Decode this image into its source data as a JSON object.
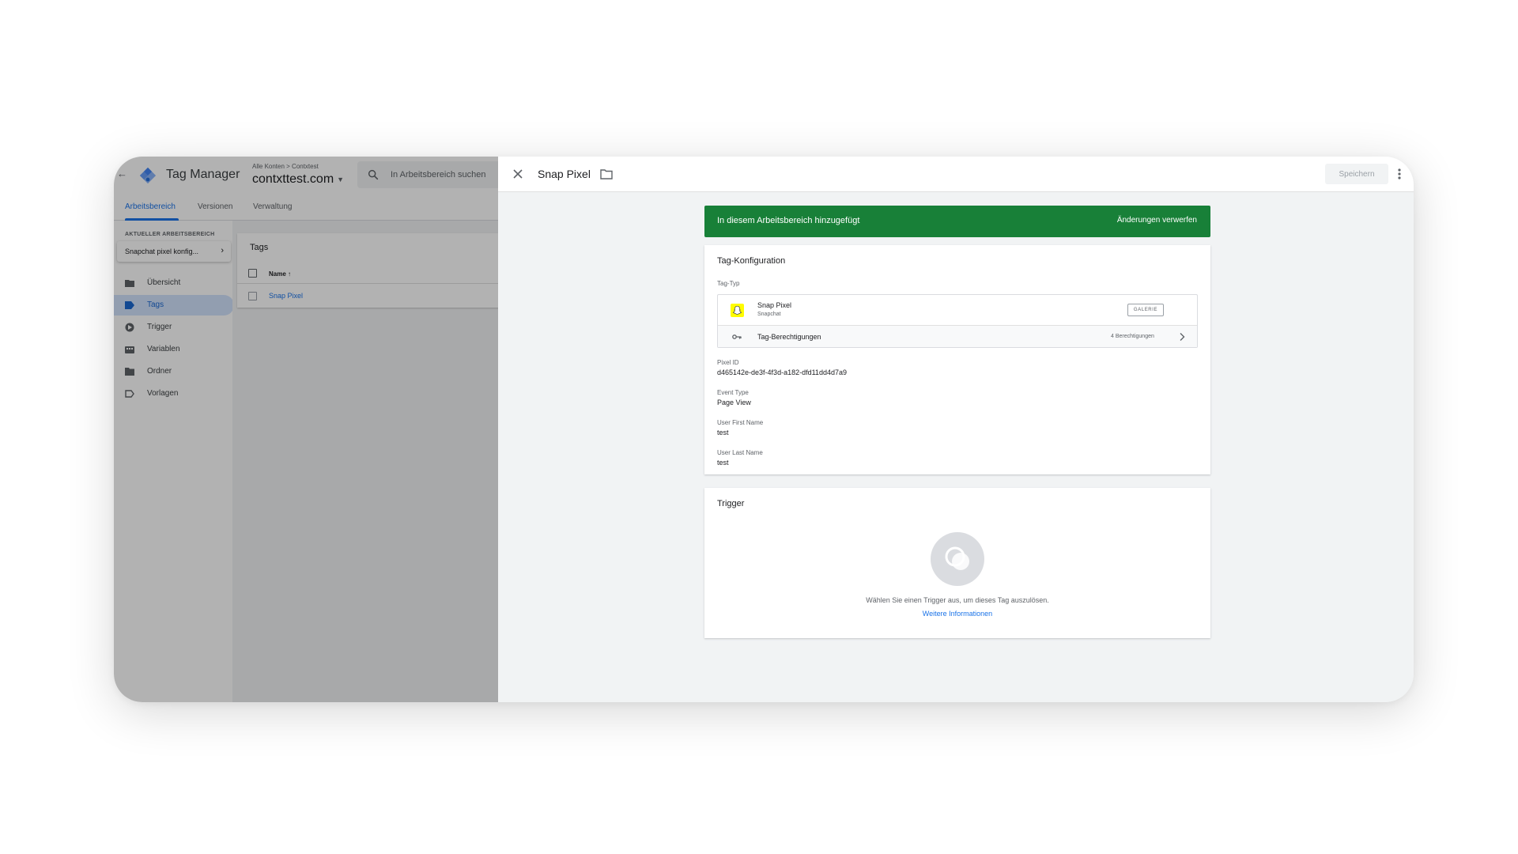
{
  "background_app": {
    "app_name": "Tag Manager",
    "breadcrumb": "Alle Konten > Contxtest",
    "account": "contxttest.com",
    "search_placeholder": "In Arbeitsbereich suchen",
    "tabs": [
      {
        "label": "Arbeitsbereich",
        "active": true
      },
      {
        "label": "Versionen",
        "active": false
      },
      {
        "label": "Verwaltung",
        "active": false
      }
    ],
    "workspace_label": "AKTUELLER ARBEITSBEREICH",
    "workspace_name": "Snapchat pixel konfig...",
    "nav": [
      {
        "label": "Übersicht",
        "icon": "overview-icon",
        "active": false
      },
      {
        "label": "Tags",
        "icon": "tag-icon",
        "active": true
      },
      {
        "label": "Trigger",
        "icon": "trigger-icon",
        "active": false
      },
      {
        "label": "Variablen",
        "icon": "variables-icon",
        "active": false
      },
      {
        "label": "Ordner",
        "icon": "folder-icon",
        "active": false
      },
      {
        "label": "Vorlagen",
        "icon": "template-icon",
        "active": false
      }
    ],
    "tags_card": {
      "title": "Tags",
      "column_name": "Name",
      "rows": [
        "Snap Pixel"
      ]
    }
  },
  "panel": {
    "title": "Snap Pixel",
    "save_label": "Speichern",
    "banner": {
      "text": "In diesem Arbeitsbereich hinzugefügt",
      "action": "Änderungen verwerfen",
      "color": "#188038"
    },
    "tag_config": {
      "title": "Tag-Konfiguration",
      "tag_type_label": "Tag-Typ",
      "tag_type": {
        "name": "Snap Pixel",
        "vendor": "Snapchat",
        "gallery_label": "GALERIE"
      },
      "permissions": {
        "label": "Tag-Berechtigungen",
        "count": "4 Berechtigungen"
      },
      "fields": [
        {
          "label": "Pixel ID",
          "value": "d465142e-de3f-4f3d-a182-dfd11dd4d7a9"
        },
        {
          "label": "Event Type",
          "value": "Page View"
        },
        {
          "label": "User First Name",
          "value": "test"
        },
        {
          "label": "User Last Name",
          "value": "test"
        }
      ]
    },
    "trigger": {
      "title": "Trigger",
      "empty_text": "Wählen Sie einen Trigger aus, um dieses Tag auszulösen.",
      "link": "Weitere Informationen"
    }
  },
  "colors": {
    "accent": "#1a73e8",
    "success": "#188038"
  }
}
